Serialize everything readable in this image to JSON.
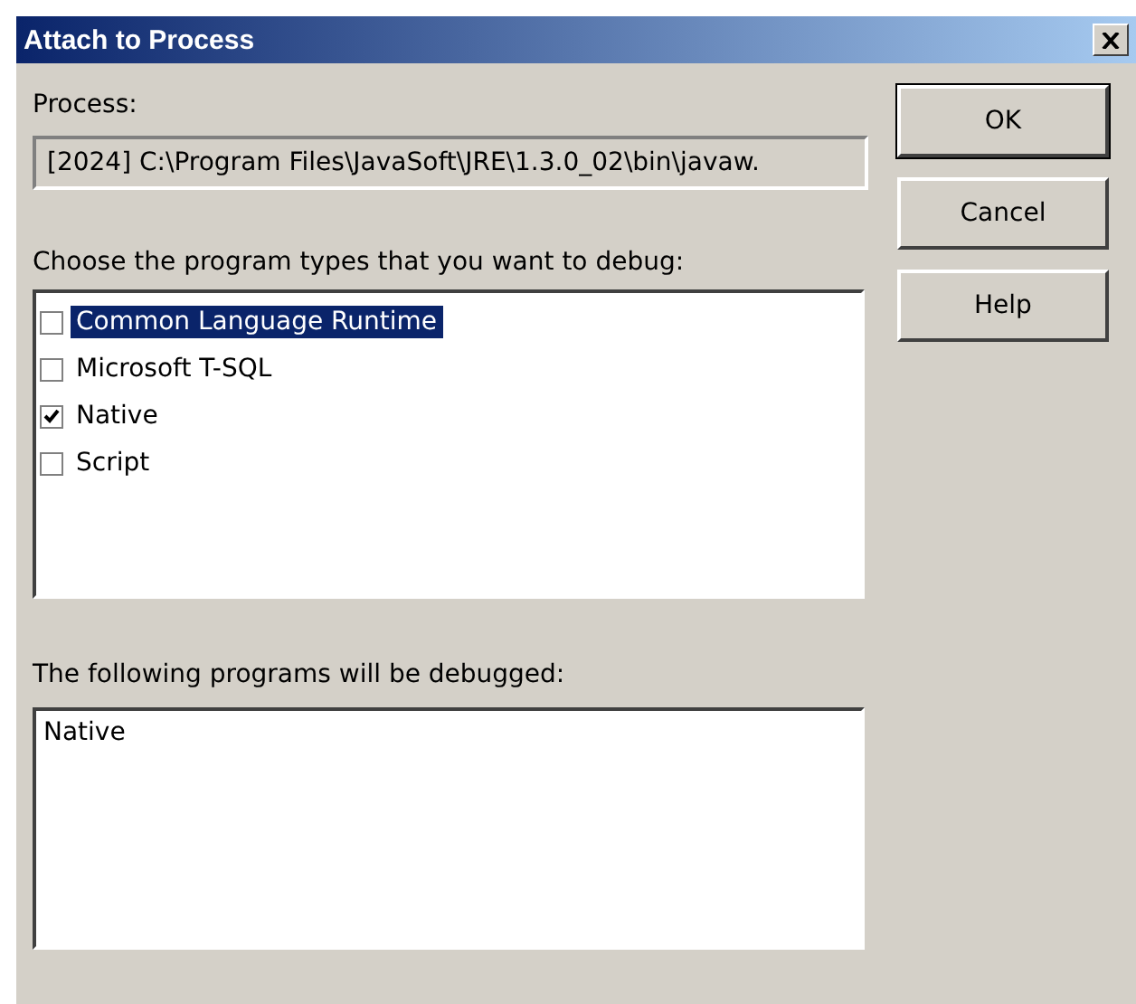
{
  "window": {
    "title": "Attach to Process"
  },
  "process": {
    "label": "Process:",
    "value": "[2024] C:\\Program Files\\JavaSoft\\JRE\\1.3.0_02\\bin\\javaw."
  },
  "types_label": "Choose the program types that you want to debug:",
  "program_types": [
    {
      "label": "Common Language Runtime",
      "checked": false,
      "selected": true
    },
    {
      "label": "Microsoft T-SQL",
      "checked": false,
      "selected": false
    },
    {
      "label": "Native",
      "checked": true,
      "selected": false
    },
    {
      "label": "Script",
      "checked": false,
      "selected": false
    }
  ],
  "debugged_label": "The following programs will be debugged:",
  "debugged_programs": [
    "Native"
  ],
  "buttons": [
    "OK",
    "Cancel",
    "Help"
  ]
}
